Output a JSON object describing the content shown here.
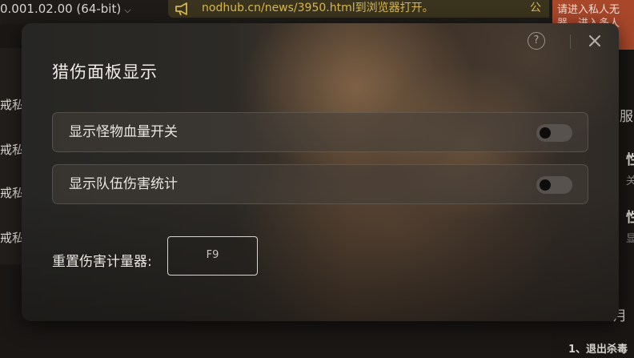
{
  "background": {
    "version_text": "0.001.02.00 (64-bit)",
    "url_text": "nodhub.cn/news/3950.html到浏览器打开。",
    "url_tail": "公",
    "right_notice_line1": "请进入私人无",
    "right_notice_line2": "器，进入多人",
    "right_items": [
      "服",
      "性",
      "关",
      "性",
      "显"
    ],
    "right_month": "月",
    "right_footer": "1、退出杀毒",
    "left_items": [
      "戒私",
      "戒私",
      "戒私",
      "戒私"
    ]
  },
  "modal": {
    "title": "猎伤面板显示",
    "toggles": [
      {
        "label": "显示怪物血量开关",
        "on": false
      },
      {
        "label": "显示队伍伤害统计",
        "on": false
      }
    ],
    "hotkey": {
      "label": "重置伤害计量器:",
      "value": "F9"
    },
    "help_glyph": "?",
    "icons": {
      "help": "help-circle-icon",
      "close": "close-icon",
      "horn": "megaphone-icon"
    }
  },
  "colors": {
    "accent_notice": "#a8472a",
    "url_text": "#d8b652",
    "toggle_off": "#57524d"
  }
}
